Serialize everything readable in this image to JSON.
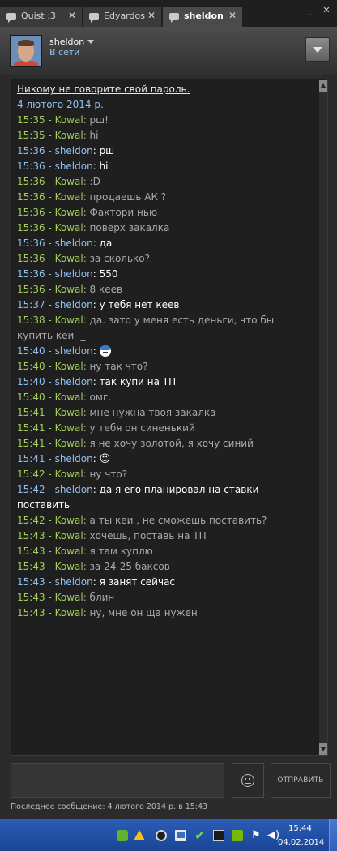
{
  "tabs": [
    {
      "label": "Quist :3",
      "close": "✕",
      "active": false
    },
    {
      "label": "Edyardos",
      "close": "✕",
      "active": false
    },
    {
      "label": "sheldon",
      "close": "✕",
      "active": true
    }
  ],
  "window_controls": {
    "minimize": "_",
    "close": "✕"
  },
  "header": {
    "username": "sheldon",
    "status": "В сети"
  },
  "chat": {
    "warning": "Никому не говорите свой пароль.",
    "date": "4 лютого 2014 р.",
    "messages": [
      {
        "time": "15:35",
        "sender": "Kowal",
        "who": "k",
        "text": "рш!"
      },
      {
        "time": "15:35",
        "sender": "Kowal",
        "who": "k",
        "text": "hi"
      },
      {
        "time": "15:36",
        "sender": "sheldon",
        "who": "s",
        "text": "рш"
      },
      {
        "time": "15:36",
        "sender": "sheldon",
        "who": "s",
        "text": "hi"
      },
      {
        "time": "15:36",
        "sender": "Kowal",
        "who": "k",
        "text": ":D"
      },
      {
        "time": "15:36",
        "sender": "Kowal",
        "who": "k",
        "text": "продаешь АК ?"
      },
      {
        "time": "15:36",
        "sender": "Kowal",
        "who": "k",
        "text": "Фактори нью"
      },
      {
        "time": "15:36",
        "sender": "Kowal",
        "who": "k",
        "text": "поверх закалка"
      },
      {
        "time": "15:36",
        "sender": "sheldon",
        "who": "s",
        "text": "да"
      },
      {
        "time": "15:36",
        "sender": "Kowal",
        "who": "k",
        "text": "за сколько?"
      },
      {
        "time": "15:36",
        "sender": "sheldon",
        "who": "s",
        "text": "550"
      },
      {
        "time": "15:36",
        "sender": "Kowal",
        "who": "k",
        "text": "8 кеев"
      },
      {
        "time": "15:37",
        "sender": "sheldon",
        "who": "s",
        "text": "у тебя нет кеев"
      },
      {
        "time": "15:38",
        "sender": "Kowal",
        "who": "k",
        "text": "да. зато у меня есть деньги, что бы купить кеи -_-"
      },
      {
        "time": "15:40",
        "sender": "sheldon",
        "who": "s",
        "text": "",
        "emoticon": "beanie-emoticon"
      },
      {
        "time": "15:40",
        "sender": "Kowal",
        "who": "k",
        "text": "ну так что?"
      },
      {
        "time": "15:40",
        "sender": "sheldon",
        "who": "s",
        "text": "так купи на ТП"
      },
      {
        "time": "15:40",
        "sender": "Kowal",
        "who": "k",
        "text": "омг."
      },
      {
        "time": "15:41",
        "sender": "Kowal",
        "who": "k",
        "text": "мне нужна твоя закалка"
      },
      {
        "time": "15:41",
        "sender": "Kowal",
        "who": "k",
        "text": "у тебя он синенький"
      },
      {
        "time": "15:41",
        "sender": "Kowal",
        "who": "k",
        "text": "я не хочу золотой, я хочу синий"
      },
      {
        "time": "15:41",
        "sender": "sheldon",
        "who": "s",
        "text": "☺"
      },
      {
        "time": "15:42",
        "sender": "Kowal",
        "who": "k",
        "text": "ну что?"
      },
      {
        "time": "15:42",
        "sender": "sheldon",
        "who": "s",
        "text": "да я его планировал на ставки поставить"
      },
      {
        "time": "15:42",
        "sender": "Kowal",
        "who": "k",
        "text": "а ты кеи , не сможешь поставить?"
      },
      {
        "time": "15:43",
        "sender": "Kowal",
        "who": "k",
        "text": "хочешь, поставь на ТП"
      },
      {
        "time": "15:43",
        "sender": "Kowal",
        "who": "k",
        "text": "я там куплю"
      },
      {
        "time": "15:43",
        "sender": "Kowal",
        "who": "k",
        "text": "за 24-25 баксов"
      },
      {
        "time": "15:43",
        "sender": "sheldon",
        "who": "s",
        "text": "я занят сейчас"
      },
      {
        "time": "15:43",
        "sender": "Kowal",
        "who": "k",
        "text": "блин"
      },
      {
        "time": "15:43",
        "sender": "Kowal",
        "who": "k",
        "text": "ну, мне он ща нужен"
      }
    ]
  },
  "composer": {
    "input_value": "",
    "send_label": "ОТПРАВИТЬ"
  },
  "footer": {
    "last_message": "Последнее сообщение: 4 лютого 2014 р. в 15:43"
  },
  "taskbar": {
    "tray_icons": [
      "gamemaker-icon",
      "antivirus-icon",
      "steam-icon",
      "display-icon",
      "check-icon",
      "network-icon",
      "nvidia-icon",
      "flag-icon",
      "volume-icon"
    ],
    "time": "15:44",
    "date": "04.02.2014"
  },
  "colors": {
    "self_name": "#8fc1f0",
    "friend_name": "#a3cf5a",
    "self_text": "#ffffff",
    "friend_text": "#aaaaaa",
    "background": "#1f1f1f",
    "taskbar": "#1f4fa6"
  }
}
